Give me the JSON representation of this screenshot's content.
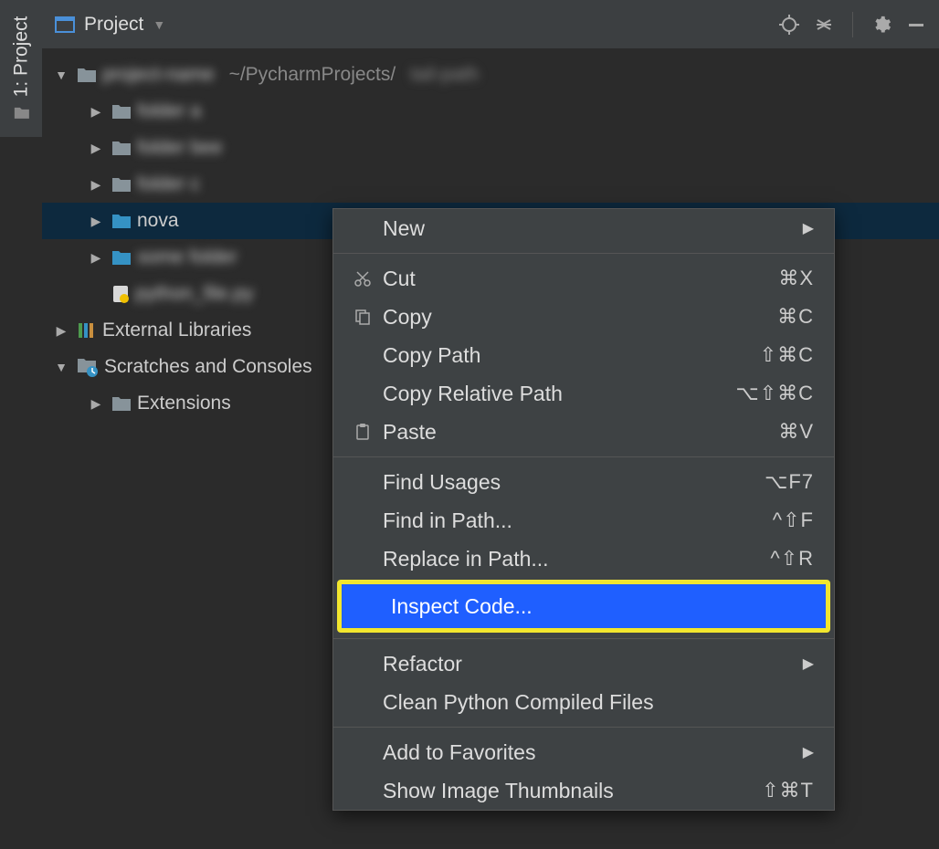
{
  "side_tab": {
    "label": "1: Project"
  },
  "panel": {
    "title": "Project"
  },
  "tree": {
    "root_path_extra": "~/PycharmProjects/",
    "nova_label": "nova",
    "external_libraries": "External Libraries",
    "scratches": "Scratches and Consoles",
    "extensions": "Extensions"
  },
  "context_menu": {
    "new": {
      "label": "New"
    },
    "cut": {
      "label": "Cut",
      "shortcut": "⌘X"
    },
    "copy": {
      "label": "Copy",
      "shortcut": "⌘C"
    },
    "copy_path": {
      "label": "Copy Path",
      "shortcut": "⇧⌘C"
    },
    "copy_relative_path": {
      "label": "Copy Relative Path",
      "shortcut": "⌥⇧⌘C"
    },
    "paste": {
      "label": "Paste",
      "shortcut": "⌘V"
    },
    "find_usages": {
      "label": "Find Usages",
      "shortcut": "⌥F7"
    },
    "find_in_path": {
      "label": "Find in Path...",
      "shortcut": "^⇧F"
    },
    "replace_in_path": {
      "label": "Replace in Path...",
      "shortcut": "^⇧R"
    },
    "inspect_code": {
      "label": "Inspect Code..."
    },
    "refactor": {
      "label": "Refactor"
    },
    "clean_python": {
      "label": "Clean Python Compiled Files"
    },
    "add_to_favorites": {
      "label": "Add to Favorites"
    },
    "show_thumbnails": {
      "label": "Show Image Thumbnails",
      "shortcut": "⇧⌘T"
    }
  }
}
